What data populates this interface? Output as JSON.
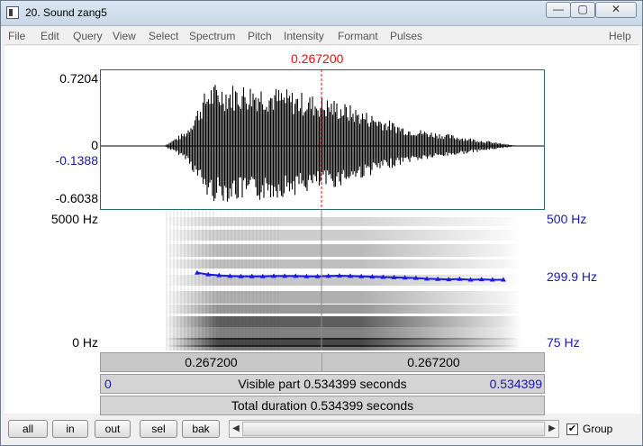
{
  "window": {
    "title": "20. Sound zang5",
    "controls": {
      "minimize": "—",
      "maximize": "▢",
      "close": "✕"
    }
  },
  "menu": {
    "items": [
      "File",
      "Edit",
      "Query",
      "View",
      "Select",
      "Spectrum",
      "Pitch",
      "Intensity",
      "Formant",
      "Pulses"
    ],
    "help": "Help"
  },
  "cursor": {
    "time": "0.267200",
    "fraction": 0.5
  },
  "waveform": {
    "max_label": "0.7204",
    "zero_label": "0",
    "cursor_value_label": "-0.1388",
    "min_label": "-0.6038"
  },
  "spectrogram": {
    "top_freq_label": "5000 Hz",
    "bottom_freq_label": "0 Hz"
  },
  "pitch": {
    "top_label": "500 Hz",
    "value_label": "299.9 Hz",
    "bottom_label": "75 Hz",
    "range_hz": [
      75,
      500
    ],
    "contour_hz": [
      310,
      305,
      302,
      300,
      299,
      299,
      299,
      300,
      300,
      300,
      299,
      299,
      300,
      301,
      300,
      299,
      298,
      297,
      296,
      295,
      294,
      292,
      291,
      290,
      291,
      289,
      290,
      289,
      289
    ]
  },
  "time_bars": {
    "left_segment": "0.267200",
    "right_segment": "0.267200",
    "start": "0",
    "visible_label": "Visible part 0.534399 seconds",
    "end": "0.534399",
    "total_label": "Total duration 0.534399 seconds"
  },
  "buttons": {
    "all": "all",
    "in": "in",
    "out": "out",
    "sel": "sel",
    "bak": "bak"
  },
  "scrollbar": {
    "left_arrow": "◀",
    "right_arrow": "▶"
  },
  "group": {
    "label": "Group",
    "checked": true,
    "check_mark": "✔"
  },
  "colors": {
    "cursor": "#e01010",
    "pitch": "#1a1ae0",
    "axis_blue": "#1a1aa8",
    "wave_frame": "#2c6a6a"
  }
}
